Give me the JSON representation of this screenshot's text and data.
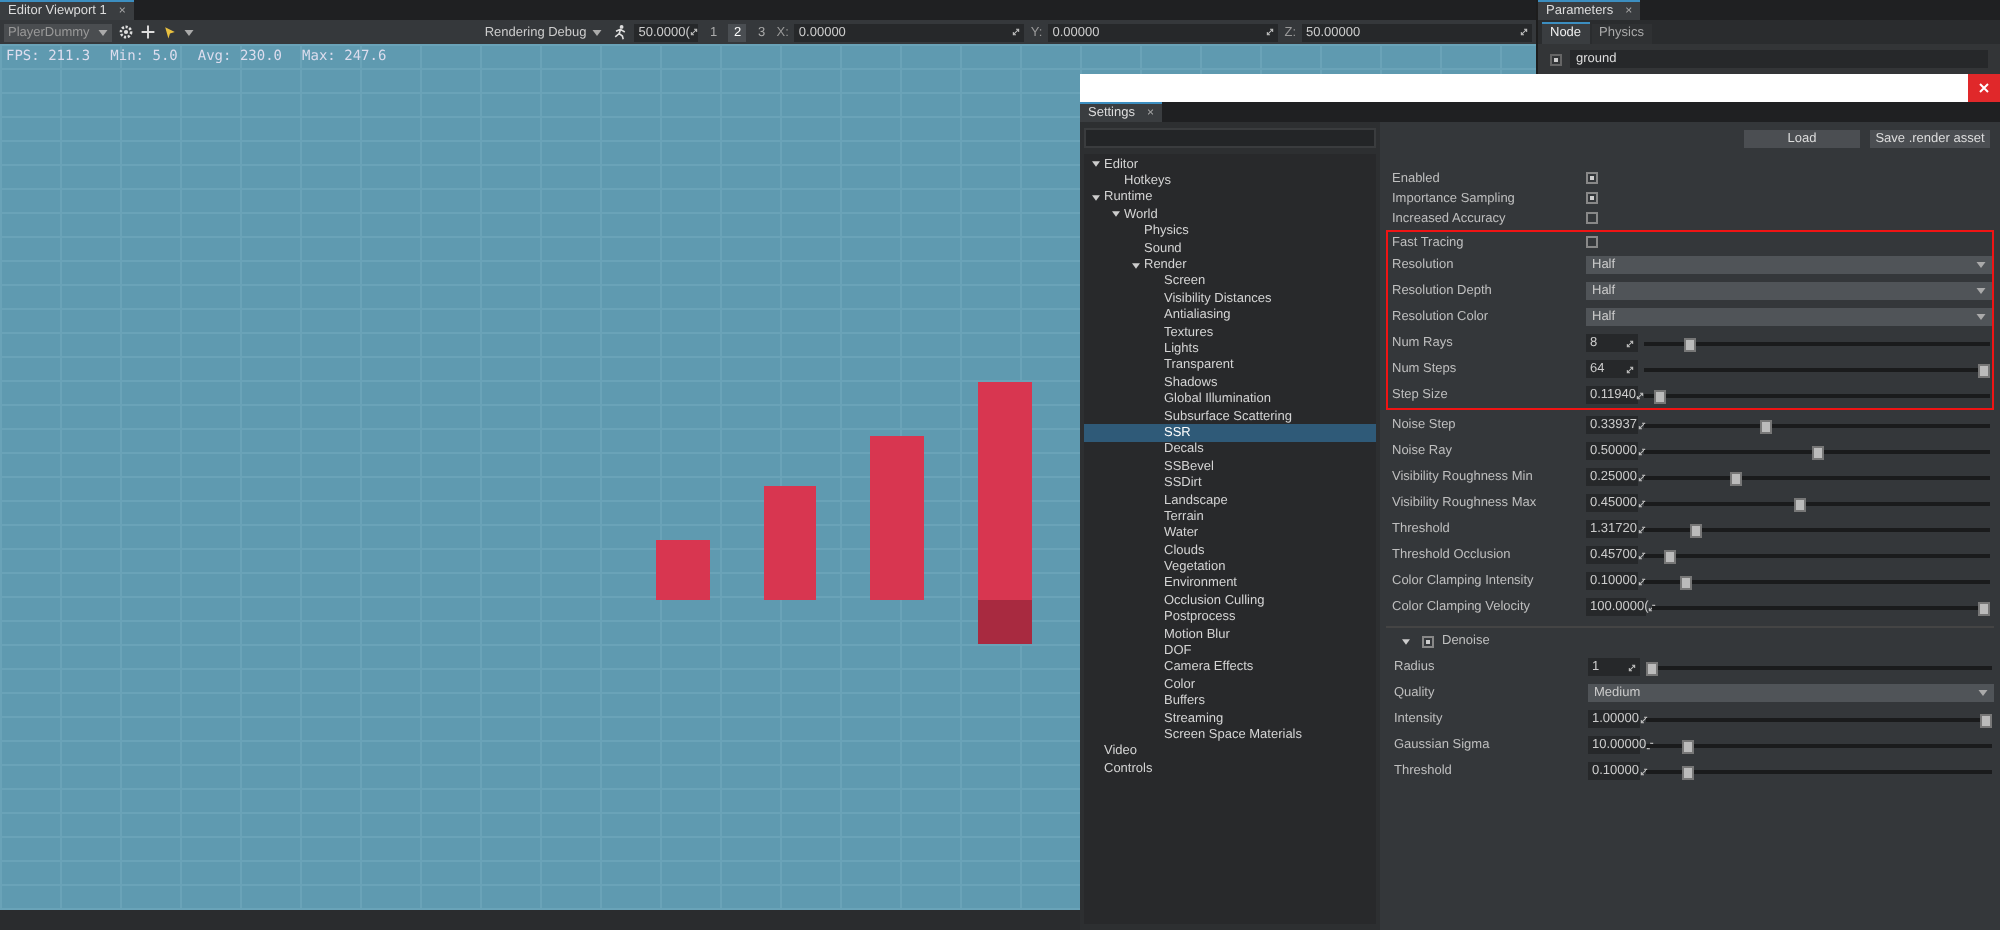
{
  "viewport": {
    "tab": {
      "label": "Editor Viewport 1",
      "close": "×"
    },
    "toolbar": {
      "camera": "PlayerDummy",
      "debug_mode": "Rendering Debug",
      "speed": "50.0000(",
      "presets": [
        {
          "label": "1",
          "selected": false
        },
        {
          "label": "2",
          "selected": true
        },
        {
          "label": "3",
          "selected": false
        }
      ],
      "coords": [
        {
          "axis": "X:",
          "value": "0.00000"
        },
        {
          "axis": "Y:",
          "value": "0.00000"
        },
        {
          "axis": "Z:",
          "value": "50.00000"
        }
      ]
    },
    "stats": [
      "FPS: 211.3",
      "Min: 5.0",
      "Avg: 230.0",
      "Max: 247.6"
    ]
  },
  "parameters": {
    "tab": {
      "label": "Parameters",
      "close": "×"
    },
    "tabs": [
      {
        "label": "Node",
        "selected": true
      },
      {
        "label": "Physics",
        "selected": false
      }
    ],
    "node_name": "ground",
    "node_enabled": true
  },
  "settings": {
    "tab": {
      "label": "Settings",
      "close": "×"
    },
    "tree": [
      {
        "label": "Editor",
        "expanded": true,
        "selected": false,
        "children": [
          {
            "label": "Hotkeys",
            "selected": false
          }
        ]
      },
      {
        "label": "Runtime",
        "expanded": true,
        "selected": false,
        "children": [
          {
            "label": "World",
            "expanded": true,
            "selected": false,
            "children": [
              {
                "label": "Physics",
                "selected": false
              },
              {
                "label": "Sound",
                "selected": false
              },
              {
                "label": "Render",
                "expanded": true,
                "selected": false,
                "children": [
                  {
                    "label": "Screen",
                    "selected": false
                  },
                  {
                    "label": "Visibility Distances",
                    "selected": false
                  },
                  {
                    "label": "Antialiasing",
                    "selected": false
                  },
                  {
                    "label": "Textures",
                    "selected": false
                  },
                  {
                    "label": "Lights",
                    "selected": false
                  },
                  {
                    "label": "Transparent",
                    "selected": false
                  },
                  {
                    "label": "Shadows",
                    "selected": false
                  },
                  {
                    "label": "Global Illumination",
                    "selected": false
                  },
                  {
                    "label": "Subsurface Scattering",
                    "selected": false
                  },
                  {
                    "label": "SSR",
                    "selected": true
                  },
                  {
                    "label": "Decals",
                    "selected": false
                  },
                  {
                    "label": "SSBevel",
                    "selected": false
                  },
                  {
                    "label": "SSDirt",
                    "selected": false
                  },
                  {
                    "label": "Landscape",
                    "selected": false
                  },
                  {
                    "label": "Terrain",
                    "selected": false
                  },
                  {
                    "label": "Water",
                    "selected": false
                  },
                  {
                    "label": "Clouds",
                    "selected": false
                  },
                  {
                    "label": "Vegetation",
                    "selected": false
                  },
                  {
                    "label": "Environment",
                    "selected": false
                  },
                  {
                    "label": "Occlusion Culling",
                    "selected": false
                  },
                  {
                    "label": "Postprocess",
                    "selected": false
                  },
                  {
                    "label": "Motion Blur",
                    "selected": false
                  },
                  {
                    "label": "DOF",
                    "selected": false
                  },
                  {
                    "label": "Camera Effects",
                    "selected": false
                  },
                  {
                    "label": "Color",
                    "selected": false
                  },
                  {
                    "label": "Buffers",
                    "selected": false
                  },
                  {
                    "label": "Streaming",
                    "selected": false
                  },
                  {
                    "label": "Screen Space Materials",
                    "selected": false
                  }
                ]
              }
            ]
          }
        ]
      },
      {
        "label": "Video",
        "selected": false
      },
      {
        "label": "Controls",
        "selected": false
      }
    ],
    "buttons": [
      "Load",
      "Save .render asset"
    ],
    "groups": [
      {
        "highlighted": false,
        "rows": [
          {
            "kind": "checkbox",
            "label": "Enabled",
            "checked": true
          },
          {
            "kind": "checkbox",
            "label": "Importance Sampling",
            "checked": true
          },
          {
            "kind": "checkbox",
            "label": "Increased Accuracy",
            "checked": false
          }
        ]
      },
      {
        "highlighted": true,
        "rows": [
          {
            "kind": "checkbox",
            "label": "Fast Tracing",
            "checked": false
          },
          {
            "kind": "dropdown",
            "label": "Resolution",
            "value": "Half"
          },
          {
            "kind": "dropdown",
            "label": "Resolution Depth",
            "value": "Half"
          },
          {
            "kind": "dropdown",
            "label": "Resolution Color",
            "value": "Half"
          },
          {
            "kind": "slider",
            "label": "Num Rays",
            "value": "8",
            "level": 0.12
          },
          {
            "kind": "slider",
            "label": "Num Steps",
            "value": "64",
            "level": 1
          },
          {
            "kind": "slider",
            "label": "Step Size",
            "value": "0.11940",
            "level": 0.03
          }
        ]
      },
      {
        "highlighted": false,
        "rows": [
          {
            "kind": "slider",
            "label": "Noise Step",
            "value": "0.33937",
            "level": 0.35
          },
          {
            "kind": "slider",
            "label": "Noise Ray",
            "value": "0.50000",
            "level": 0.5
          },
          {
            "kind": "slider",
            "label": "Visibility Roughness Min",
            "value": "0.25000",
            "level": 0.26
          },
          {
            "kind": "slider",
            "label": "Visibility Roughness Max",
            "value": "0.45000",
            "level": 0.45
          },
          {
            "kind": "slider",
            "label": "Threshold",
            "value": "1.31720",
            "level": 0.14
          },
          {
            "kind": "slider",
            "label": "Threshold Occlusion",
            "value": "0.45700",
            "level": 0.06
          },
          {
            "kind": "slider",
            "label": "Color Clamping Intensity",
            "value": "0.10000",
            "level": 0.11
          },
          {
            "kind": "slider",
            "label": "Color Clamping Velocity",
            "value": "100.0000(",
            "level": 1
          }
        ]
      }
    ],
    "section": {
      "label": "Denoise",
      "expanded": true,
      "checked": true,
      "rows": [
        {
          "kind": "slider",
          "label": "Radius",
          "value": "1",
          "level": 0
        },
        {
          "kind": "dropdown",
          "label": "Quality",
          "value": "Medium"
        },
        {
          "kind": "slider",
          "label": "Intensity",
          "value": "1.00000",
          "level": 1
        },
        {
          "kind": "slider",
          "label": "Gaussian Sigma",
          "value": "10.00000",
          "level": 0.11
        },
        {
          "kind": "slider",
          "label": "Threshold",
          "value": "0.10000",
          "level": 0.11
        }
      ]
    }
  }
}
